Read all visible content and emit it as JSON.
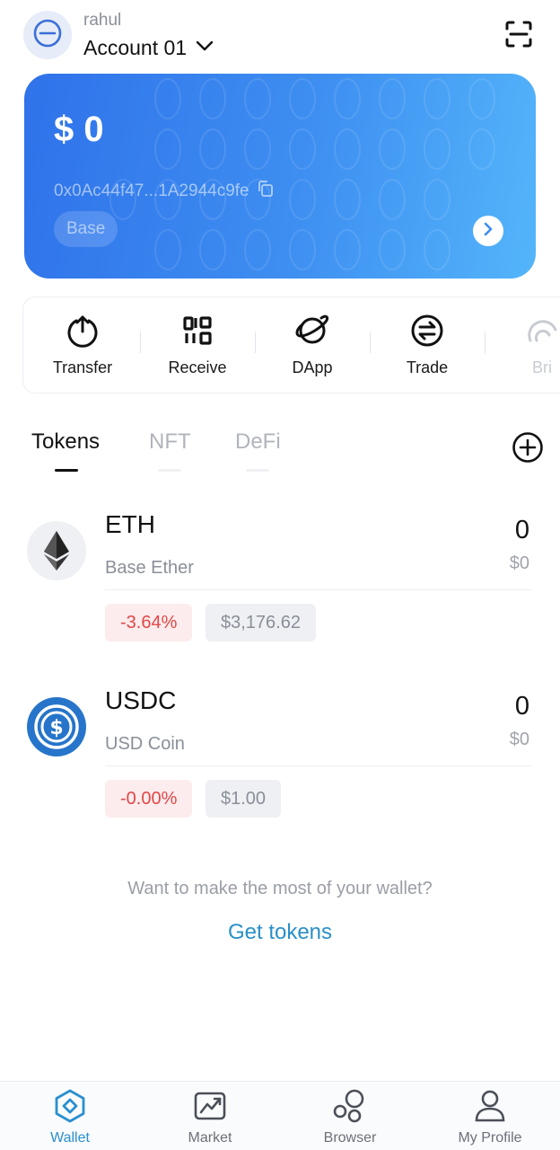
{
  "header": {
    "user_name": "rahul",
    "account_name": "Account 01"
  },
  "card": {
    "balance": "$ 0",
    "address": "0x0Ac44f47...1A2944c9fe",
    "network": "Base"
  },
  "actions": [
    {
      "label": "Transfer",
      "icon": "transfer-icon"
    },
    {
      "label": "Receive",
      "icon": "qr-code-icon"
    },
    {
      "label": "DApp",
      "icon": "planet-icon"
    },
    {
      "label": "Trade",
      "icon": "swap-icon"
    },
    {
      "label": "Bri",
      "icon": "bridge-icon"
    }
  ],
  "tabs": [
    {
      "label": "Tokens",
      "active": true
    },
    {
      "label": "NFT",
      "active": false
    },
    {
      "label": "DeFi",
      "active": false
    }
  ],
  "tokens": [
    {
      "symbol": "ETH",
      "name": "Base Ether",
      "amount": "0",
      "value": "$0",
      "change": "-3.64%",
      "price": "$3,176.62",
      "icon": "ethereum-logo-icon"
    },
    {
      "symbol": "USDC",
      "name": "USD Coin",
      "amount": "0",
      "value": "$0",
      "change": "-0.00%",
      "price": "$1.00",
      "icon": "usdc-logo-icon"
    }
  ],
  "promo": {
    "text": "Want to make the most of your wallet?",
    "link": "Get tokens"
  },
  "bottom_nav": [
    {
      "label": "Wallet",
      "icon": "wallet-icon",
      "active": true
    },
    {
      "label": "Market",
      "icon": "market-chart-icon",
      "active": false
    },
    {
      "label": "Browser",
      "icon": "browser-bubbles-icon",
      "active": false
    },
    {
      "label": "My Profile",
      "icon": "profile-icon",
      "active": false
    }
  ],
  "colors": {
    "card_gradient_start": "#2f72ea",
    "card_gradient_end": "#54b5fa",
    "negative_change": "#e04848",
    "link": "#2a8fc8",
    "nav_active": "#2a8fd0"
  }
}
